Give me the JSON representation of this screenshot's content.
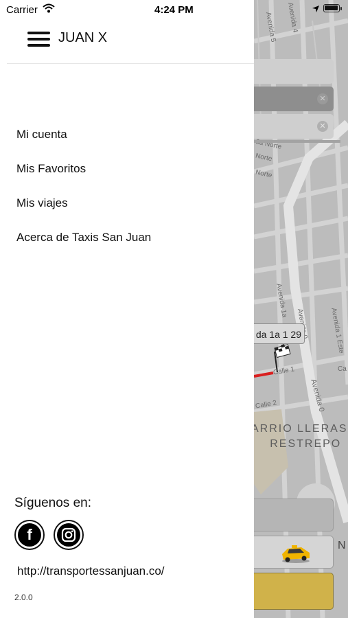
{
  "status_bar": {
    "carrier": "Carrier",
    "time": "4:24 PM"
  },
  "drawer": {
    "user_name": "JUAN X",
    "menu_items": [
      {
        "label": "Mi cuenta"
      },
      {
        "label": "Mis Favoritos"
      },
      {
        "label": "Mis viajes"
      },
      {
        "label": "Acerca de Taxis San Juan"
      }
    ],
    "follow_label": "Síguenos en:",
    "social": [
      "facebook-icon",
      "instagram-icon"
    ],
    "website": "http://transportessanjuan.co/",
    "version": "2.0.0"
  },
  "map": {
    "address_callout": "da 1a 1 29",
    "neighborhood_line1": "ARRIO LLERAS",
    "neighborhood_line2": "RESTREPO",
    "street_labels": [
      "Avenida 5",
      "Avenida 4",
      "6a Norte",
      "Norte",
      "Norte",
      "Avenida 1a",
      "Avenida 0",
      "Avenida 1 Este",
      "Calle 1",
      "Calle 2",
      "Avenida 0",
      "Ca",
      "N"
    ],
    "colors": {
      "route": "#d92020",
      "confirm_button": "#d0b24a",
      "taxi": "#f0b400"
    }
  }
}
